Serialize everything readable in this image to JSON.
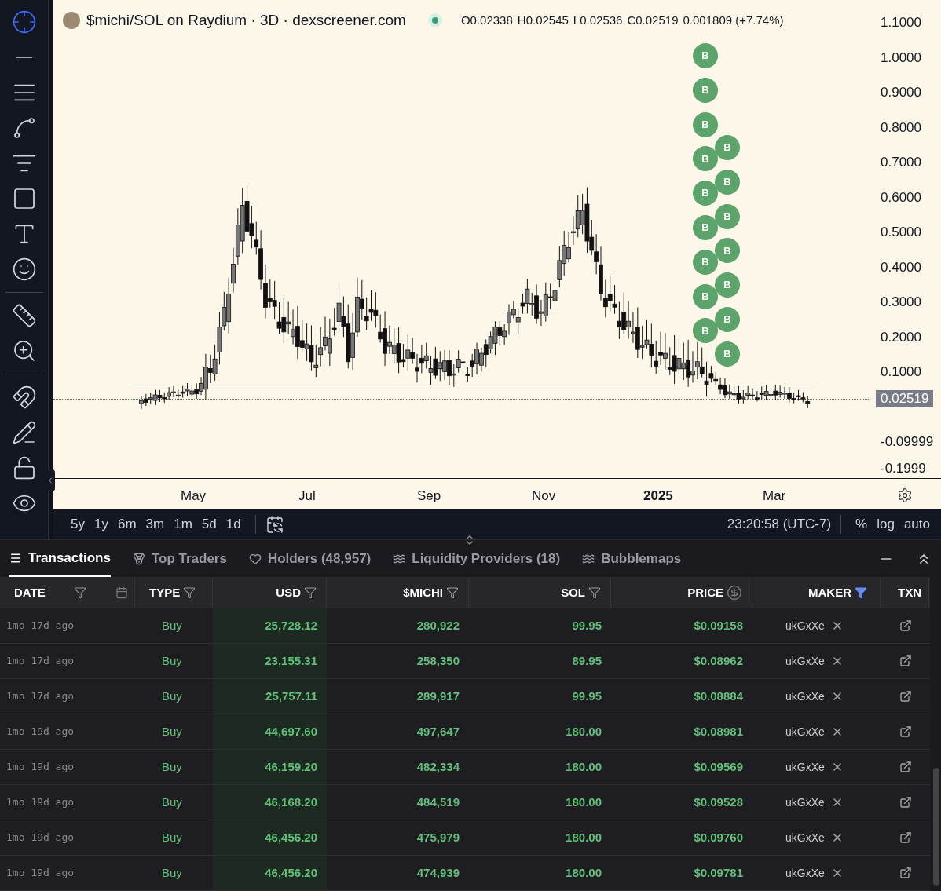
{
  "chart": {
    "title": "$michi/SOL on Raydium · 3D · dexscreener.com",
    "ohlc": [
      "O0.02338",
      "H0.02545",
      "L0.02536",
      "C0.02519",
      "0.001809 (+7.74%)"
    ],
    "y_labels": [
      "1.1000",
      "1.0000",
      "0.9000",
      "0.8000",
      "0.7000",
      "0.6000",
      "0.5000",
      "0.4000",
      "0.3000",
      "0.2000",
      "0.1000",
      "-0.09999",
      "-0.1999"
    ],
    "price_tag": "0.02519",
    "x_labels": [
      {
        "label": "May",
        "bold": false
      },
      {
        "label": "Jul",
        "bold": false
      },
      {
        "label": "Sep",
        "bold": false
      },
      {
        "label": "Nov",
        "bold": false
      },
      {
        "label": "2025",
        "bold": true
      },
      {
        "label": "Mar",
        "bold": false
      }
    ],
    "markers": [
      {
        "label": "B"
      },
      {
        "label": "B"
      },
      {
        "label": "B"
      },
      {
        "label": "B"
      },
      {
        "label": "B"
      },
      {
        "label": "B"
      },
      {
        "label": "B"
      },
      {
        "label": "B"
      },
      {
        "label": "B"
      },
      {
        "label": "B"
      },
      {
        "label": "B"
      },
      {
        "label": "B"
      },
      {
        "label": "B"
      },
      {
        "label": "B"
      },
      {
        "label": "B"
      },
      {
        "label": "B"
      }
    ]
  },
  "ranges": [
    "5y",
    "1y",
    "6m",
    "3m",
    "1m",
    "5d",
    "1d"
  ],
  "clock": "23:20:58 (UTC-7)",
  "scale_options": [
    "%",
    "log",
    "auto"
  ],
  "tabs": [
    {
      "label": "Transactions",
      "selected": true
    },
    {
      "label": "Top Traders",
      "selected": false
    },
    {
      "label": "Holders (48,957)",
      "selected": false
    },
    {
      "label": "Liquidity Providers (18)",
      "selected": false
    },
    {
      "label": "Bubblemaps",
      "selected": false
    }
  ],
  "columns": [
    {
      "label": "DATE",
      "filter_active": false
    },
    {
      "label": "TYPE",
      "filter_active": false
    },
    {
      "label": "USD",
      "filter_active": false
    },
    {
      "label": "$MICHI",
      "filter_active": false
    },
    {
      "label": "SOL",
      "filter_active": false
    },
    {
      "label": "PRICE",
      "filter_active": false
    },
    {
      "label": "MAKER",
      "filter_active": true
    },
    {
      "label": "TXN",
      "filter_active": false
    }
  ],
  "rows": [
    {
      "date": "1mo 17d ago",
      "type": "Buy",
      "usd": "25,728.12",
      "michi": "280,922",
      "sol": "99.95",
      "price": "$0.09158",
      "maker": "ukGxXe"
    },
    {
      "date": "1mo 17d ago",
      "type": "Buy",
      "usd": "23,155.31",
      "michi": "258,350",
      "sol": "89.95",
      "price": "$0.08962",
      "maker": "ukGxXe"
    },
    {
      "date": "1mo 17d ago",
      "type": "Buy",
      "usd": "25,757.11",
      "michi": "289,917",
      "sol": "99.95",
      "price": "$0.08884",
      "maker": "ukGxXe"
    },
    {
      "date": "1mo 19d ago",
      "type": "Buy",
      "usd": "44,697.60",
      "michi": "497,647",
      "sol": "180.00",
      "price": "$0.08981",
      "maker": "ukGxXe"
    },
    {
      "date": "1mo 19d ago",
      "type": "Buy",
      "usd": "46,159.20",
      "michi": "482,334",
      "sol": "180.00",
      "price": "$0.09569",
      "maker": "ukGxXe"
    },
    {
      "date": "1mo 19d ago",
      "type": "Buy",
      "usd": "46,168.20",
      "michi": "484,519",
      "sol": "180.00",
      "price": "$0.09528",
      "maker": "ukGxXe"
    },
    {
      "date": "1mo 19d ago",
      "type": "Buy",
      "usd": "46,456.20",
      "michi": "475,979",
      "sol": "180.00",
      "price": "$0.09760",
      "maker": "ukGxXe"
    },
    {
      "date": "1mo 19d ago",
      "type": "Buy",
      "usd": "46,456.20",
      "michi": "474,939",
      "sol": "180.00",
      "price": "$0.09781",
      "maker": "ukGxXe"
    }
  ]
}
